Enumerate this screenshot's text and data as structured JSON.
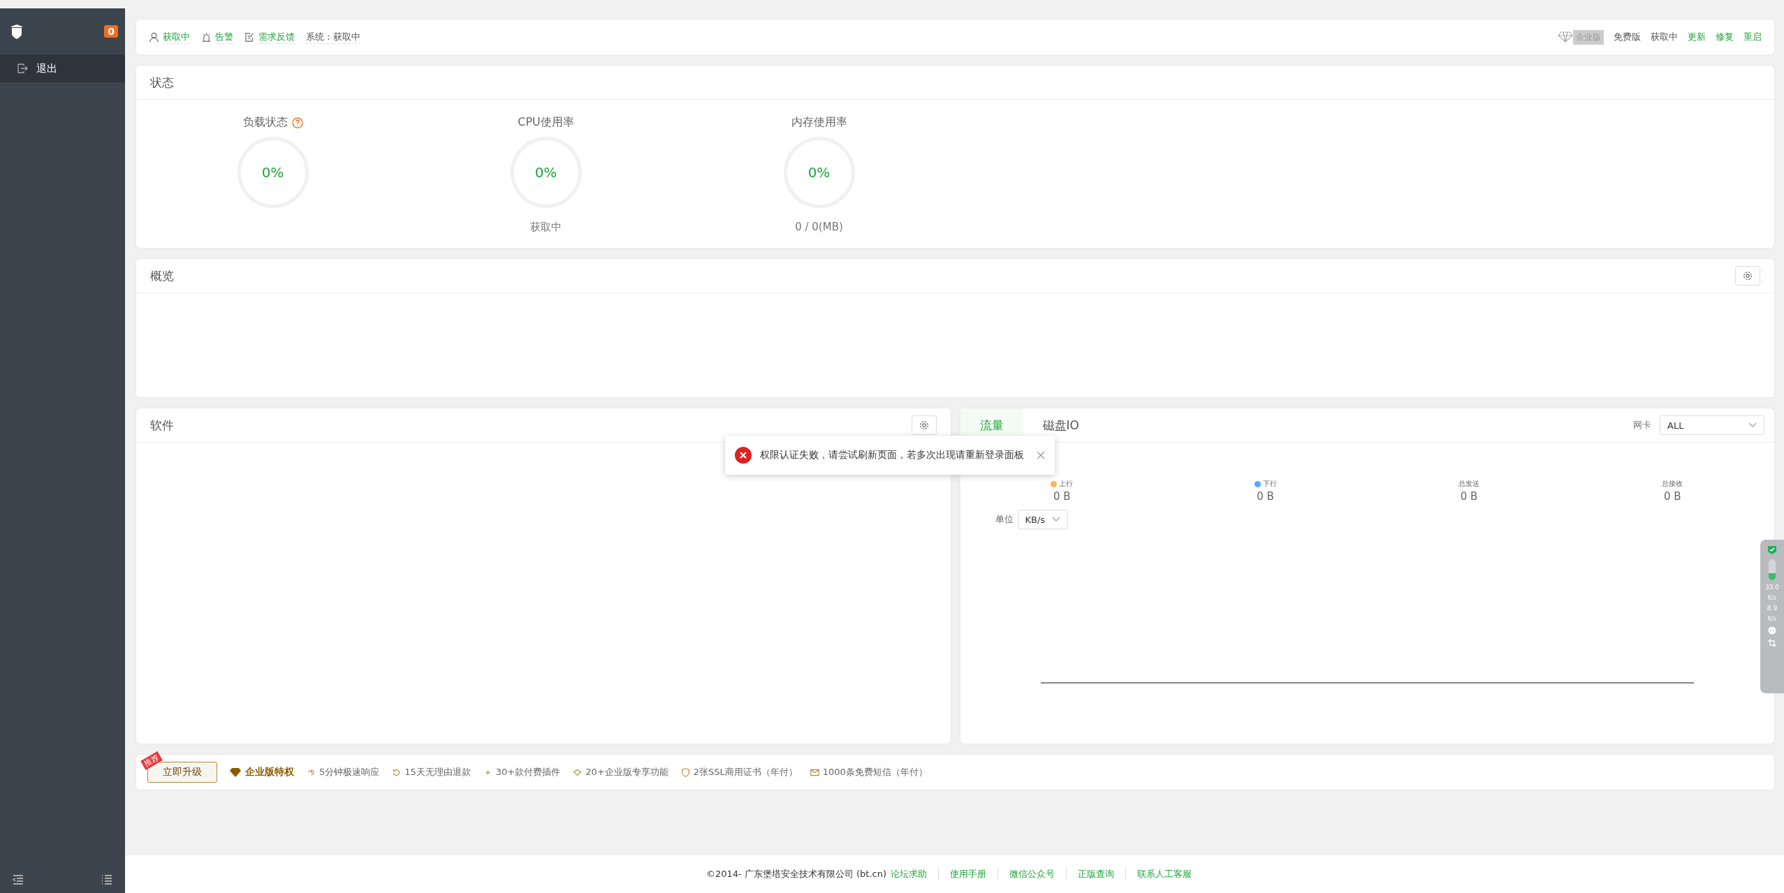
{
  "sidebar": {
    "badge": "0",
    "items": [
      {
        "label": "退出",
        "selected": true
      }
    ]
  },
  "topbar": {
    "left": [
      {
        "kind": "user",
        "text": "获取中"
      },
      {
        "kind": "alarm",
        "text": "告警"
      },
      {
        "kind": "feedback",
        "text": "需求反馈"
      },
      {
        "kind": "system",
        "text": "系统：获取中"
      }
    ],
    "edition_badge": "企业版",
    "version": "免费版",
    "status": "获取中",
    "actions": [
      "更新",
      "修复",
      "重启"
    ]
  },
  "status": {
    "title": "状态",
    "gauges": [
      {
        "label": "负载状态",
        "help": true,
        "value": "0%"
      },
      {
        "label": "CPU使用率",
        "help": false,
        "value": "0%",
        "caption": "获取中"
      },
      {
        "label": "内存使用率",
        "help": false,
        "value": "0%",
        "caption": "0 / 0(MB)"
      }
    ]
  },
  "overview": {
    "title": "概览"
  },
  "software": {
    "title": "软件"
  },
  "traffic": {
    "tabs": [
      {
        "label": "流量",
        "selected": true
      },
      {
        "label": "磁盘IO",
        "selected": false
      }
    ],
    "nic_label": "网卡",
    "nic_value": "ALL",
    "unit_label": "单位",
    "unit_value": "KB/s",
    "stats": [
      {
        "label": "上行",
        "value": "0 B",
        "color": "#f7b851"
      },
      {
        "label": "下行",
        "value": "0 B",
        "color": "#52a9ff"
      },
      {
        "label": "总发送",
        "value": "0 B"
      },
      {
        "label": "总接收",
        "value": "0 B"
      }
    ]
  },
  "upgrade": {
    "ribbon": "推荐",
    "button": "立即升级",
    "title": "企业版特权",
    "perks": [
      {
        "kind": "speed",
        "text": "5分钟极速响应"
      },
      {
        "kind": "refund",
        "text": "15天无理由退款"
      },
      {
        "kind": "plugin",
        "text": "30+款付费插件"
      },
      {
        "kind": "feature",
        "text": "20+企业版专享功能"
      },
      {
        "kind": "ssl",
        "text": "2张SSL商用证书（年付）"
      },
      {
        "kind": "sms",
        "text": "1000条免费短信（年付）"
      }
    ]
  },
  "footer": {
    "copyright": "©2014- 广东堡塔安全技术有限公司 (bt.cn)",
    "links": [
      "论坛求助",
      "使用手册",
      "微信公众号",
      "正版查询",
      "联系人工客服"
    ]
  },
  "toast": {
    "kind": "error",
    "text": "权限认证失败，请尝试刷新页面，若多次出现请重新登录面板"
  },
  "float_widget": {
    "level": 0.35,
    "up": "33.0",
    "down": "8.9",
    "up_unit": "K/s",
    "down_unit": "K/s"
  }
}
